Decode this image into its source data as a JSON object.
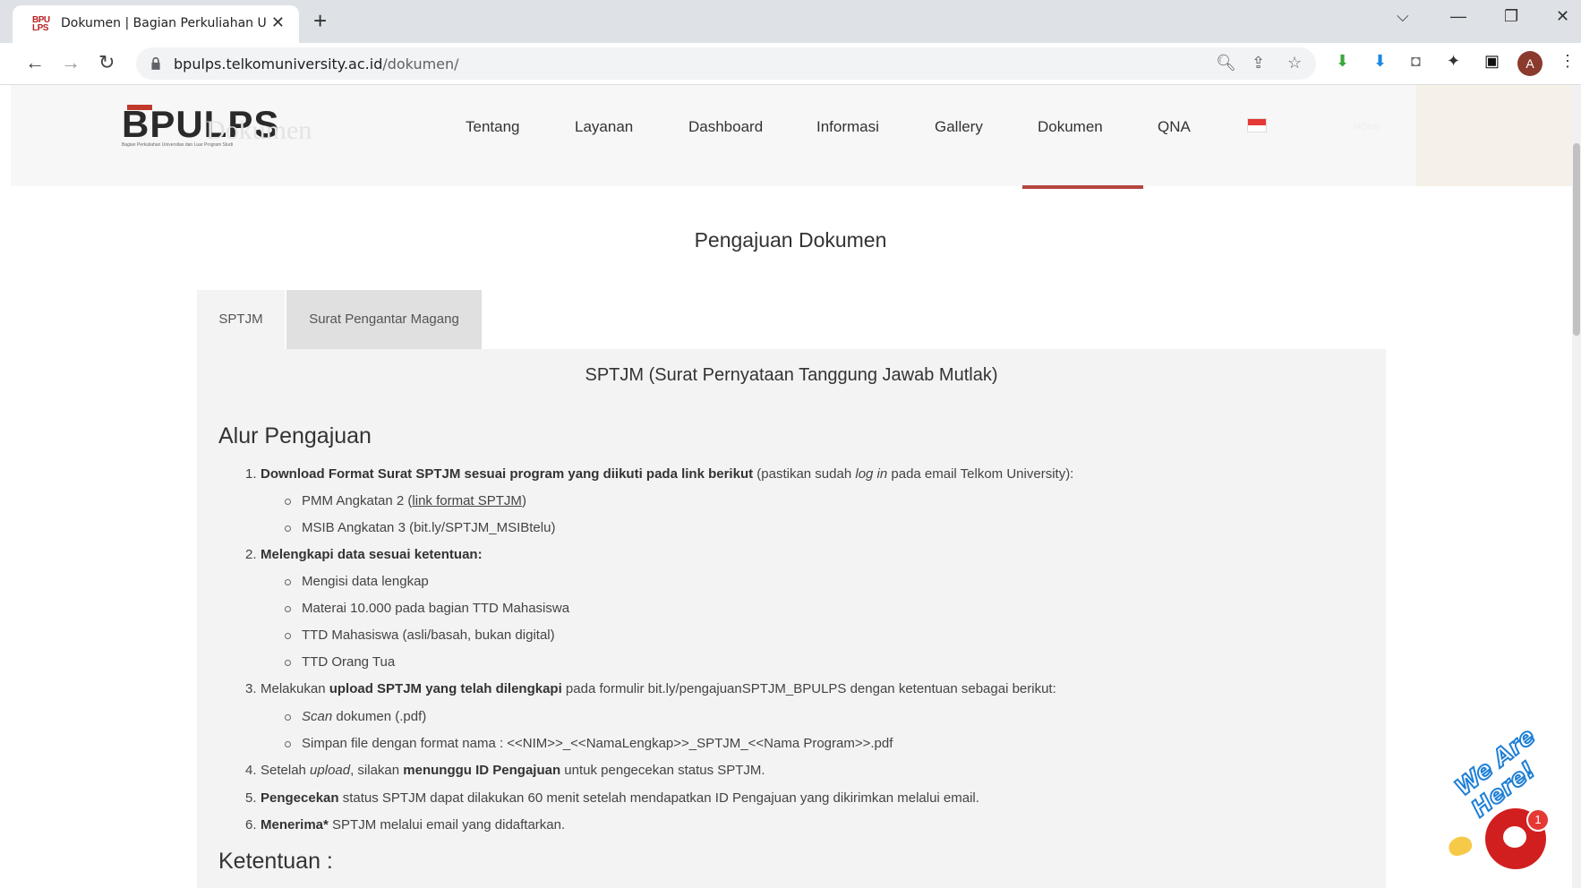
{
  "browser": {
    "tab_title": "Dokumen | Bagian Perkuliahan U",
    "tab_close": "✕",
    "new_tab": "+",
    "favicon_text": "BPU LPS",
    "url_host": "bpulps.telkomuniversity.ac.id",
    "url_path": "/dokumen/",
    "avatar_letter": "A",
    "icons": [
      "back-arrow-icon",
      "forward-arrow-icon",
      "reload-icon",
      "lock-icon",
      "zoom-icon",
      "share-icon",
      "star-icon",
      "extension-icons",
      "puzzle-icon",
      "sidebar-icon",
      "menu-icon"
    ]
  },
  "site": {
    "logo_text": "BPULPS",
    "logo_sub": "Bagian Perkuliahan Universitas dan Luar Program Studi",
    "ghost_title": "Dokumen",
    "home_ghost": "HOME",
    "nav": [
      "Tentang",
      "Layanan",
      "Dashboard",
      "Informasi",
      "Gallery",
      "Dokumen",
      "QNA"
    ],
    "active_nav": "Dokumen",
    "flag_icon": "indonesia-flag-icon",
    "accent_color": "#b5463e"
  },
  "content": {
    "page_title": "Pengajuan Dokumen",
    "tabs": [
      "SPTJM",
      "Surat Pengantar Magang"
    ],
    "panel_title": "SPTJM (Surat Pernyataan Tanggung Jawab Mutlak)",
    "alur_heading": "Alur Pengajuan",
    "ketentuan_heading": "Ketentuan :",
    "steps": {
      "s1_bold": "Download Format Surat SPTJM sesuai program yang diikuti pada link berikut",
      "s1_rest1": " (pastikan sudah ",
      "s1_italic": "log in",
      "s1_rest2": " pada email Telkom University):",
      "s1_b1_pre": "PMM Angkatan 2 (",
      "s1_b1_link": "link format SPTJM",
      "s1_b1_post": ")",
      "s1_b2": "MSIB Angkatan 3 (bit.ly/SPTJM_MSIBtelu)",
      "s2_bold": "Melengkapi data sesuai ketentuan:",
      "s2_b1": "Mengisi data lengkap",
      "s2_b2": "Materai 10.000 pada bagian TTD Mahasiswa",
      "s2_b3": "TTD Mahasiswa (asli/basah, bukan digital)",
      "s2_b4": "TTD Orang Tua",
      "s3_pre": "Melakukan ",
      "s3_bold": "upload SPTJM yang telah dilengkapi",
      "s3_post": " pada formulir bit.ly/pengajuanSPTJM_BPULPS dengan ketentuan sebagai berikut:",
      "s3_b1_italic": "Scan",
      "s3_b1_rest": " dokumen (.pdf)",
      "s3_b2": "Simpan file dengan format nama : <<NIM>>_<<NamaLengkap>>_SPTJM_<<Nama Program>>.pdf",
      "s4_pre": "Setelah ",
      "s4_italic": "upload",
      "s4_mid": ", silakan ",
      "s4_bold": "menunggu ID Pengajuan",
      "s4_post": " untuk pengecekan status SPTJM.",
      "s5_bold": "Pengecekan",
      "s5_post": " status SPTJM dapat dilakukan 60 menit setelah mendapatkan ID Pengajuan yang dikirimkan melalui email.",
      "s6_bold": "Menerima*",
      "s6_post": " SPTJM melalui email yang didaftarkan."
    },
    "numbers": [
      "1.",
      "2.",
      "3.",
      "4.",
      "5.",
      "6."
    ]
  },
  "chat": {
    "badge": "1",
    "banner": "We Are Here!",
    "color": "#d11f1f"
  }
}
